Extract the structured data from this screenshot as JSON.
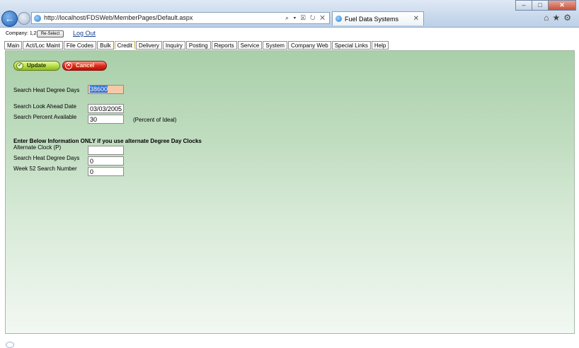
{
  "browser": {
    "url": "http://localhost/FDSWeb/MemberPages/Default.aspx",
    "address_tools": "⌕ ▾ ☒ ↻ ✕",
    "tab_title": "Fuel Data Systems",
    "tab_close": "✕",
    "right_icons": "⌂★⚙",
    "window_controls": {
      "minimize": "–",
      "maximize": "□",
      "close": "✕"
    },
    "back_glyph": "←",
    "forward_glyph": "→"
  },
  "header": {
    "company_label": "Company: 1,2,3",
    "reselect_label": "Re-Select",
    "logout_label": "Log Out"
  },
  "menu": [
    {
      "label": "Main"
    },
    {
      "label": "Act/Loc Maint"
    },
    {
      "label": "File Codes"
    },
    {
      "label": "Bulk"
    },
    {
      "label": "Credit",
      "active": true
    },
    {
      "label": "Delivery"
    },
    {
      "label": "Inquiry"
    },
    {
      "label": "Posting"
    },
    {
      "label": "Reports"
    },
    {
      "label": "Service"
    },
    {
      "label": "System"
    },
    {
      "label": "Company Web"
    },
    {
      "label": "Special Links"
    },
    {
      "label": "Help"
    }
  ],
  "actions": {
    "update_label": "Update",
    "update_glyph": "✓",
    "cancel_label": "Cancel",
    "cancel_glyph": "✕"
  },
  "form": {
    "heat_degree_days_label": "Search Heat Degree Days",
    "heat_degree_days_value": "38600",
    "look_ahead_date_label": "Search Look Ahead Date",
    "look_ahead_date_value": "03/03/2005",
    "percent_available_label": "Search Percent Available",
    "percent_available_value": "30",
    "percent_note": "(Percent of Ideal)",
    "alternate_section_title": "Enter Below Information ONLY if you use alternate Degree Day Clocks",
    "alternate_clock_label": "Alternate Clock (P)",
    "alternate_clock_value": "",
    "alt_heat_degree_days_label": "Search Heat Degree Days",
    "alt_heat_degree_days_value": "0",
    "week52_label": "Week 52 Search Number",
    "week52_value": "0"
  }
}
